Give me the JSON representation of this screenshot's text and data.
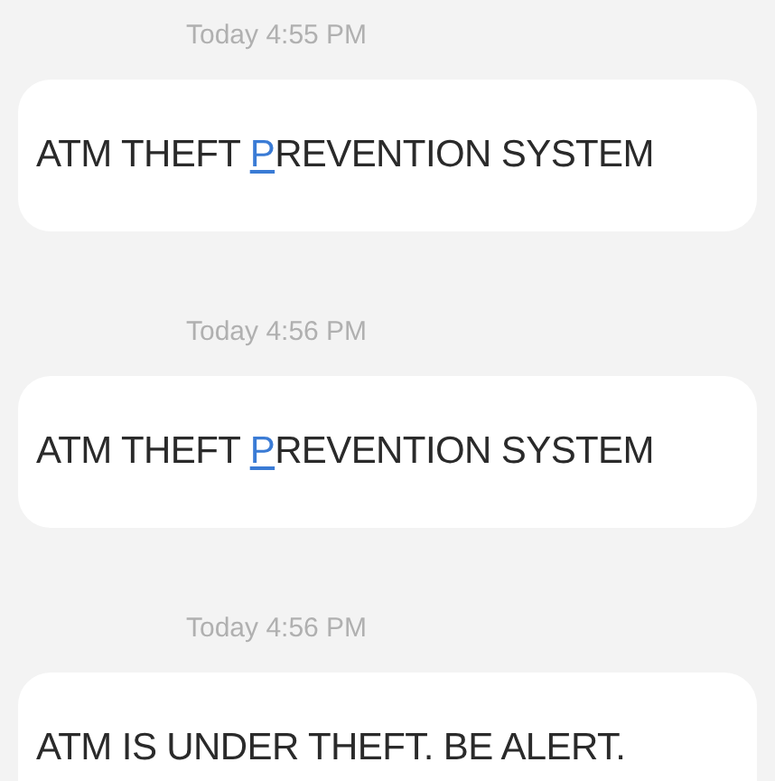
{
  "messages": [
    {
      "time": "Today 4:55 PM",
      "parts": [
        {
          "text": "ATM THEFT "
        },
        {
          "text": "P",
          "highlighted": true
        },
        {
          "text": "REVENTION SYSTEM"
        }
      ]
    },
    {
      "time": "Today 4:56 PM",
      "parts": [
        {
          "text": "ATM THEFT "
        },
        {
          "text": "P",
          "highlighted": true
        },
        {
          "text": "REVENTION SYSTEM"
        }
      ]
    },
    {
      "time": "Today 4:56 PM",
      "parts": [
        {
          "text": "ATM IS UNDER THEFT. BE ALERT."
        }
      ]
    }
  ]
}
